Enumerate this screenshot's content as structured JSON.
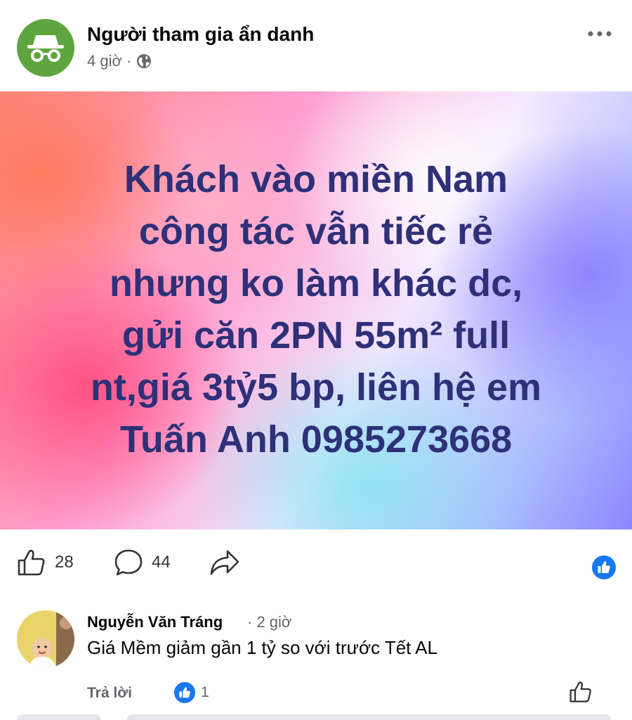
{
  "post": {
    "author": "Người tham gia ẩn danh",
    "time": "4 giờ",
    "separator": "·",
    "text": "Khách vào miền Nam\ncông tác vẫn tiếc rẻ\nnhưng ko làm khác dc,\ngửi căn 2PN 55m² full\nnt,giá 3tỷ5 bp, liên hệ em\nTuấn Anh 0985273668",
    "text_color": "#2e3078"
  },
  "actions": {
    "like_count": "28",
    "comment_count": "44"
  },
  "comment": {
    "author": "Nguyễn Văn Tráng",
    "time": "· 2 giờ",
    "text": "Giá Mềm giảm gần 1 tỷ so với trước Tết AL",
    "reply_label": "Trả lời",
    "reaction_count": "1"
  },
  "colors": {
    "accent": "#1877f2",
    "anon_avatar": "#5ea53f",
    "secondary_text": "#65676b"
  },
  "icons": [
    "incognito-icon",
    "globe-icon",
    "more-icon",
    "like-icon",
    "comment-icon",
    "share-icon",
    "like-reaction-icon"
  ]
}
